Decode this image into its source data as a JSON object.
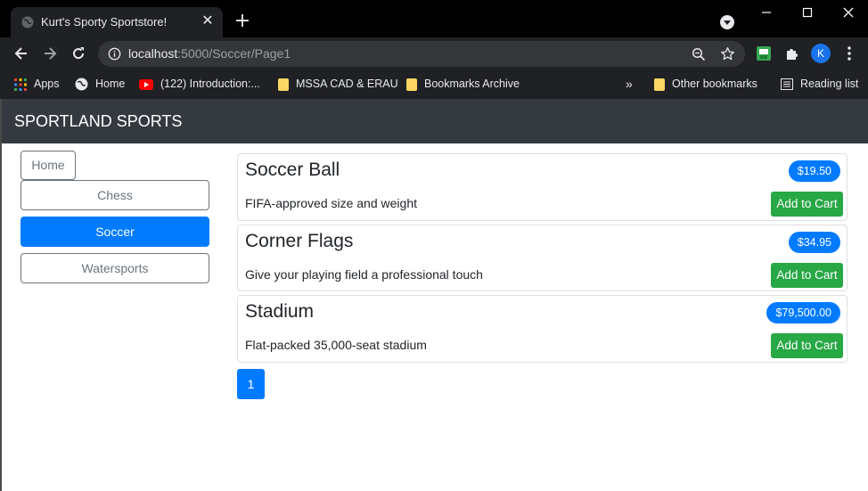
{
  "browser": {
    "tab_title": "Kurt's Sporty Sportstore!",
    "tab_close": "✕",
    "new_tab": "+",
    "url_host": "localhost",
    "url_path": ":5000/Soccer/Page1",
    "profile_initial": "K",
    "bookmarks": [
      {
        "label": "Apps",
        "icon": "apps-grid-icon"
      },
      {
        "label": "Home",
        "icon": "globe-icon"
      },
      {
        "label": "(122) Introduction:...",
        "icon": "youtube-icon"
      },
      {
        "label": "MSSA CAD & ERAU",
        "icon": "folder-icon"
      },
      {
        "label": "Bookmarks Archive",
        "icon": "folder-icon"
      }
    ],
    "overflow": "»",
    "other_bookmarks": "Other bookmarks",
    "reading_list": "Reading list"
  },
  "site": {
    "brand": "SPORTLAND SPORTS"
  },
  "sidebar": {
    "home": "Home",
    "categories": [
      {
        "label": "Chess",
        "active": false
      },
      {
        "label": "Soccer",
        "active": true
      },
      {
        "label": "Watersports",
        "active": false
      }
    ]
  },
  "products": [
    {
      "name": "Soccer Ball",
      "price": "$19.50",
      "description": "FIFA-approved size and weight",
      "action": "Add to Cart"
    },
    {
      "name": "Corner Flags",
      "price": "$34.95",
      "description": "Give your playing field a professional touch",
      "action": "Add to Cart"
    },
    {
      "name": "Stadium",
      "price": "$79,500.00",
      "description": "Flat-packed 35,000-seat stadium",
      "action": "Add to Cart"
    }
  ],
  "pagination": {
    "current": "1"
  },
  "colors": {
    "primary": "#007bff",
    "success": "#28a745",
    "navbar": "#343a40",
    "outline": "#6c757d"
  }
}
